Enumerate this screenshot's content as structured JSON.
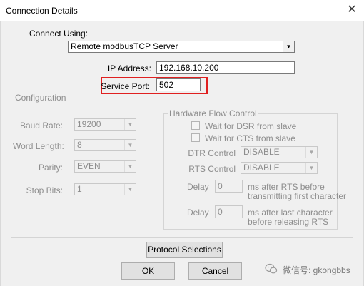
{
  "window": {
    "title": "Connection Details",
    "close_glyph": "✕"
  },
  "connect": {
    "label": "Connect Using:",
    "selected": "Remote modbusTCP Server",
    "ip_label": "IP Address:",
    "ip_value": "192.168.10.200",
    "port_label": "Service Port:",
    "port_value": "502"
  },
  "configuration": {
    "title": "Configuration",
    "baud_label": "Baud Rate:",
    "baud_value": "19200",
    "word_label": "Word Length:",
    "word_value": "8",
    "parity_label": "Parity:",
    "parity_value": "EVEN",
    "stop_label": "Stop Bits:",
    "stop_value": "1"
  },
  "flow": {
    "title": "Hardware Flow Control",
    "dsr_label": "Wait for DSR from slave",
    "cts_label": "Wait for CTS from slave",
    "dtr_label": "DTR Control",
    "dtr_value": "DISABLE",
    "rts_label": "RTS Control",
    "rts_value": "DISABLE",
    "delay_label": "Delay",
    "delay1_value": "0",
    "delay1_desc_1": "ms after RTS before",
    "delay1_desc_2": "transmitting first character",
    "delay2_value": "0",
    "delay2_desc_1": "ms after last character",
    "delay2_desc_2": "before releasing RTS"
  },
  "buttons": {
    "protocol": "Protocol Selections",
    "ok": "OK",
    "cancel": "Cancel"
  },
  "watermark": {
    "text": "微信号: gkongbbs"
  },
  "colors": {
    "highlight": "#e02020",
    "disabled_text": "#8d8d8d"
  }
}
